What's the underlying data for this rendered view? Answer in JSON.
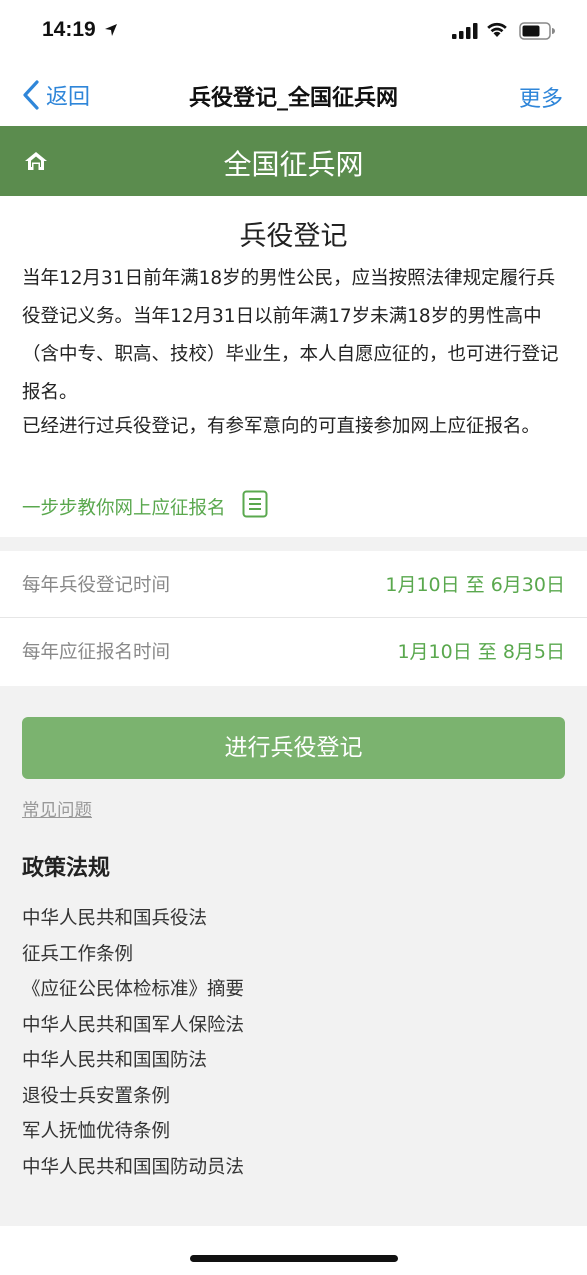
{
  "status_bar": {
    "time": "14:19",
    "icons": [
      "location-arrow-icon",
      "signal-icon",
      "wifi-icon",
      "battery-icon"
    ]
  },
  "nav": {
    "back_label": "返回",
    "title": "兵役登记_全国征兵网",
    "more_label": "更多"
  },
  "header": {
    "site_title": "全国征兵网",
    "color": "#5b8c4e"
  },
  "intro": {
    "heading": "兵役登记",
    "paragraph1": "当年12月31日前年满18岁的男性公民，应当按照法律规定履行兵役登记义务。当年12月31日以前年满17岁未满18岁的男性高中（含中专、职高、技校）毕业生，本人自愿应征的，也可进行登记报名。",
    "paragraph2": "已经进行过兵役登记，有参军意向的可直接参加网上应征报名。",
    "tutorial_link": "一步步教你网上应征报名"
  },
  "schedule": [
    {
      "label": "每年兵役登记时间",
      "value": "1月10日 至 6月30日"
    },
    {
      "label": "每年应征报名时间",
      "value": "1月10日 至 8月5日"
    }
  ],
  "actions": {
    "register_button": "进行兵役登记",
    "faq_link": "常见问题"
  },
  "policy": {
    "heading": "政策法规",
    "items": [
      "中华人民共和国兵役法",
      "征兵工作条例",
      "《应征公民体检标准》摘要",
      "中华人民共和国军人保险法",
      "中华人民共和国国防法",
      "退役士兵安置条例",
      "军人抚恤优待条例",
      "中华人民共和国国防动员法"
    ]
  },
  "colors": {
    "accent_green": "#5aa84e",
    "button_green": "#7bb36f",
    "link_blue": "#2f86d9"
  }
}
